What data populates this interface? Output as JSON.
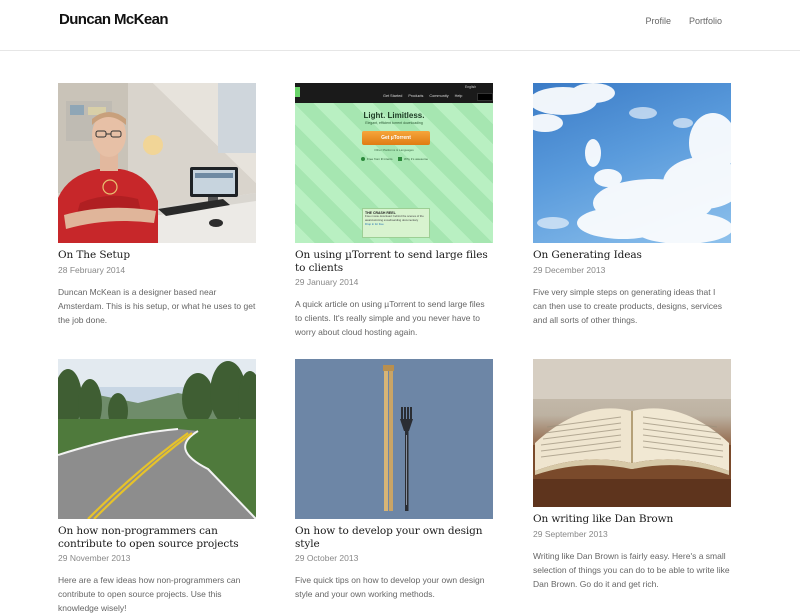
{
  "site": {
    "title": "Duncan McKean"
  },
  "nav": [
    {
      "label": "Profile"
    },
    {
      "label": "Portfolio"
    }
  ],
  "posts": [
    {
      "title": "On The Setup",
      "date": "28 February 2014",
      "excerpt": "Duncan McKean is a designer based near Amsterdam. This is his setup, or what he uses to get the job done.",
      "image": "man-at-desk-photo"
    },
    {
      "title": "On using µTorrent to send large files to clients",
      "date": "29 January 2014",
      "excerpt": "A quick article on using µTorrent to send large files to clients. It's really simple and you never have to worry about cloud hosting again.",
      "image": "utorrent-website-screenshot",
      "shot": {
        "nav": [
          "Get Started",
          "Products",
          "Community",
          "Help"
        ],
        "lang": "English",
        "headline": "Light. Limitless.",
        "sub": "Elegant, efficient torrent downloading",
        "button": "Get µTorrent",
        "small": "Other Platforms & Languages",
        "check1": "Free from ill intents",
        "check2": "Why it's awesome",
        "box_title": "THE CRASH REEL",
        "box_text": "Free movie download: behind the scenes of the award-winning snowboarding documentary",
        "box_link": "Drop in for free"
      }
    },
    {
      "title": "On Generating Ideas",
      "date": "29 December 2013",
      "excerpt": "Five very simple steps on generating ideas that I can then use to create products, designs, services and all sorts of other things.",
      "image": "blue-sky-clouds-photo"
    },
    {
      "title": "On how non-programmers can contribute to open source projects",
      "date": "29 November 2013",
      "excerpt": "Here are a few ideas how non-programmers can contribute to open source projects. Use this knowledge wisely!",
      "image": "curving-road-photo"
    },
    {
      "title": "On how to develop your own design style",
      "date": "29 October 2013",
      "excerpt": "Five quick tips on how to develop your own design style and your own working methods.",
      "image": "chopsticks-and-fork-photo"
    },
    {
      "title": "On writing like Dan Brown",
      "date": "29 September 2013",
      "excerpt": "Writing like Dan Brown is fairly easy. Here's a small selection of things you can do to be able to write like Dan Brown. Go do it and get rich.",
      "image": "open-book-photo"
    }
  ]
}
